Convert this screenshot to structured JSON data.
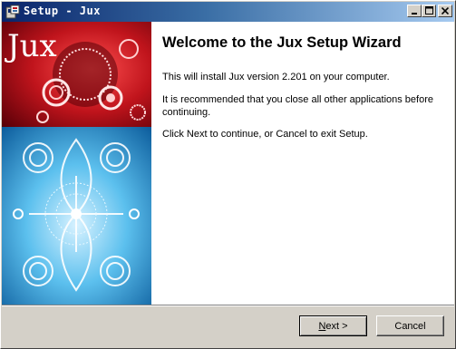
{
  "window": {
    "title": "Setup - Jux"
  },
  "titlebar_buttons": {
    "minimize": "minimize-icon",
    "maximize": "maximize-icon",
    "close": "close-icon"
  },
  "banner": {
    "logo_text": "Jux"
  },
  "wizard": {
    "heading": "Welcome to the Jux Setup Wizard",
    "line1": "This will install Jux version 2.201 on your computer.",
    "line2": "It is recommended that you close all other applications before continuing.",
    "line3": "Click Next to continue, or Cancel to exit Setup."
  },
  "buttons": {
    "next_mnemonic": "N",
    "next_rest": "ext >",
    "cancel": "Cancel"
  },
  "colors": {
    "titlebar_start": "#0a246a",
    "titlebar_end": "#a6caf0",
    "banner_red": "#c0141c",
    "banner_blue": "#3aa8e0"
  }
}
